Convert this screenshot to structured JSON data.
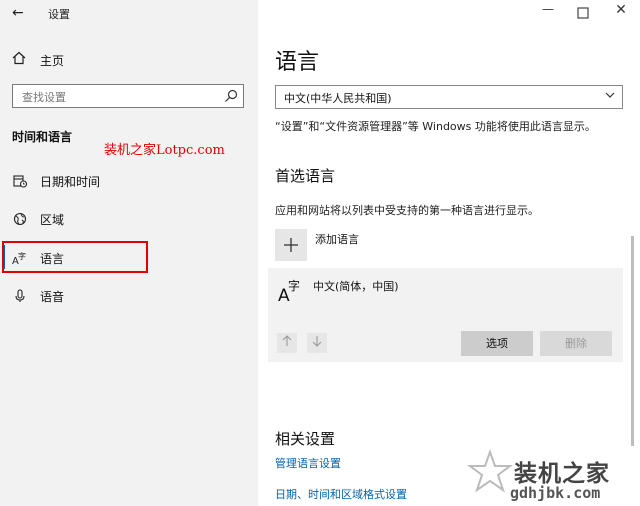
{
  "window": {
    "title": "设置",
    "back_icon": "←",
    "minimize_icon": "—",
    "close_icon": "✕"
  },
  "sidebar": {
    "home_label": "主页",
    "search_placeholder": "查找设置",
    "section_title": "时间和语言",
    "items": [
      {
        "label": "日期和时间",
        "icon": "calendar-clock-icon"
      },
      {
        "label": "区域",
        "icon": "globe-icon"
      },
      {
        "label": "语言",
        "icon": "language-icon"
      },
      {
        "label": "语音",
        "icon": "microphone-icon"
      }
    ]
  },
  "watermarks": {
    "top": "装机之家Lotpc.com",
    "bottom_line1": "装机之家",
    "bottom_line2": "gdhjbk.com"
  },
  "main": {
    "title": "语言",
    "display_language_value": "中文(中华人民共和国)",
    "display_language_desc": "“设置”和“文件资源管理器”等 Windows 功能将使用此语言显示。",
    "preferred_title": "首选语言",
    "preferred_desc": "应用和网站将以列表中受支持的第一种语言进行显示。",
    "add_language_label": "添加语言",
    "installed_languages": [
      {
        "name": "中文(简体，中国)"
      }
    ],
    "options_button": "选项",
    "remove_button": "删除",
    "related_title": "相关设置",
    "link_manage": "管理语言设置",
    "link_formats": "日期、时间和区域格式设置"
  },
  "colors": {
    "sidebar_bg": "#f2f2f2",
    "accent": "#0063b1",
    "highlight_red": "#e00000"
  }
}
